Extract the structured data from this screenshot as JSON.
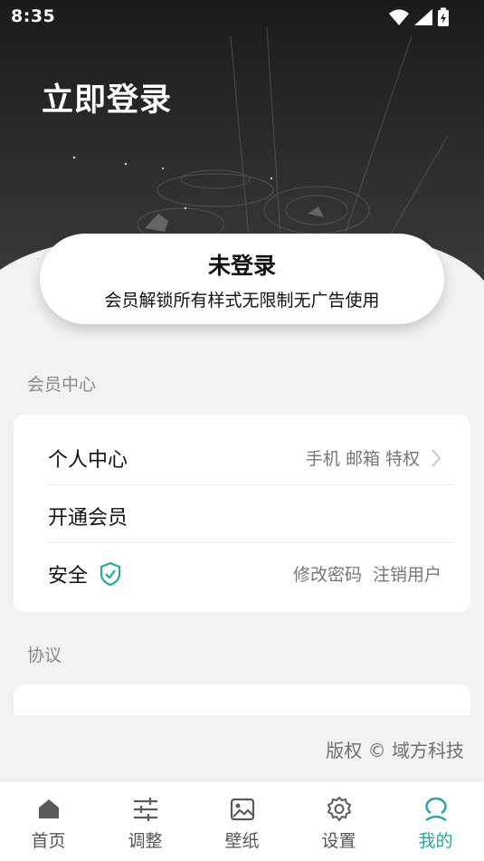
{
  "status_bar": {
    "time": "8:35"
  },
  "header": {
    "title": "立即登录"
  },
  "login_card": {
    "status": "未登录",
    "subtitle": "会员解锁所有样式无限制无广告使用"
  },
  "member_section": {
    "title": "会员中心",
    "rows": [
      {
        "label": "个人中心",
        "detail": "手机 邮箱 特权"
      },
      {
        "label": "开通会员"
      },
      {
        "label": "安全",
        "actions": [
          "修改密码",
          "注销用户"
        ]
      }
    ]
  },
  "agreement_section": {
    "title": "协议"
  },
  "copyright": "版权 © 域方科技",
  "tabbar": {
    "active": "我的",
    "items": [
      {
        "label": "首页",
        "icon": "home-icon"
      },
      {
        "label": "调整",
        "icon": "sliders-icon"
      },
      {
        "label": "壁纸",
        "icon": "image-icon"
      },
      {
        "label": "设置",
        "icon": "gear-icon"
      },
      {
        "label": "我的",
        "icon": "profile-icon"
      }
    ]
  },
  "colors": {
    "accent": "#26a7a3",
    "hero_dark": "#1e1d1f",
    "background": "#f2f2f2"
  }
}
